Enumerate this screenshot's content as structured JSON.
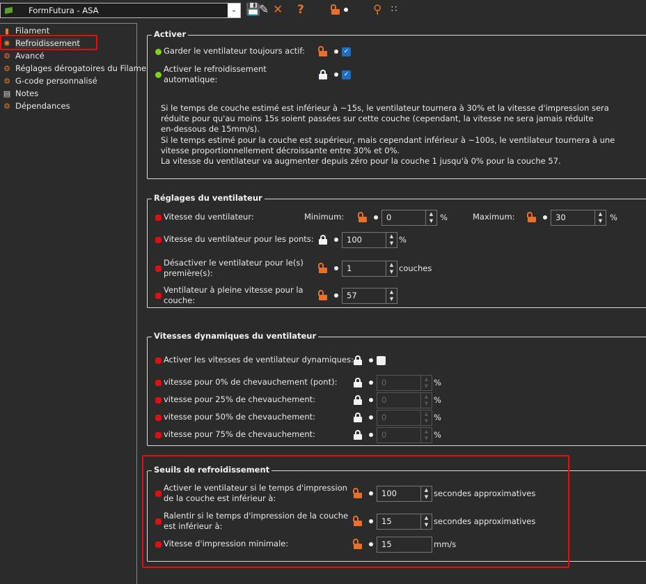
{
  "toolbar": {
    "preset": "FormFutura - ASA",
    "icons": [
      "save-icon",
      "edit-icon",
      "delete-icon",
      "help-icon",
      "lock-open-icon",
      "dot-icon",
      "search-icon",
      "compare-icon"
    ]
  },
  "colors": {
    "orange": "#e8702a",
    "green": "#7ed321",
    "red": "#e01010",
    "checkbox": "#1e6fc4"
  },
  "sidebar": {
    "items": [
      {
        "label": "Filament",
        "icon": "filament-icon"
      },
      {
        "label": "Refroidissement",
        "icon": "fan-icon",
        "selected": true
      },
      {
        "label": "Avancé",
        "icon": "gears-icon"
      },
      {
        "label": "Réglages dérogatoires du Filame",
        "icon": "gears-icon"
      },
      {
        "label": "G-code personnalisé",
        "icon": "gcode-icon"
      },
      {
        "label": "Notes",
        "icon": "notes-icon"
      },
      {
        "label": "Dépendances",
        "icon": "gears-icon"
      }
    ]
  },
  "groups": [
    {
      "title": "Activer",
      "rows": [
        {
          "label": "Garder le ventilateur toujours actif:",
          "status": "green",
          "lock": "open",
          "type": "checkbox",
          "checked": true
        },
        {
          "label": "Activer le refroidissement\nautomatique:",
          "status": "green",
          "lock": "closed",
          "type": "checkbox",
          "checked": true
        }
      ],
      "description": "Si le temps de couche estimé est inférieur à ~15s, le ventilateur tournera à 30% et la vitesse d'impression sera\nréduite pour qu'au moins 15s soient passées sur cette couche (cependant, la vitesse ne sera jamais réduite\nen-dessous de 15mm/s).\nSi le temps estimé pour la couche est supérieur, mais cependant inférieur à ~100s, le ventilateur tournera à une\nvitesse proportionnellement décroissante entre 30% et 0%.\nLa vitesse du ventilateur va augmenter depuis zéro pour la couche 1 jusqu'à 0% pour la couche 57."
    },
    {
      "title": "Réglages du ventilateur",
      "rows": [
        {
          "label": "Vitesse du ventilateur:",
          "status": "red",
          "sub": [
            {
              "label": "Minimum:",
              "lock": "open",
              "value": "0",
              "unit": "%"
            },
            {
              "label": "Maximum:",
              "lock": "open",
              "value": "30",
              "unit": "%"
            }
          ]
        },
        {
          "label": "Vitesse du ventilateur pour les ponts:",
          "status": "red",
          "lock": "closed",
          "type": "spin",
          "value": "100",
          "unit": "%"
        },
        {
          "label": "Désactiver le ventilateur pour le(s)\npremière(s):",
          "status": "red",
          "lock": "open",
          "type": "spin",
          "value": "1",
          "unit": "couches"
        },
        {
          "label": "Ventilateur à pleine vitesse pour la\ncouche:",
          "status": "red",
          "lock": "open",
          "type": "spin",
          "value": "57",
          "unit": ""
        }
      ]
    },
    {
      "title": "Vitesses dynamiques du ventilateur",
      "rows": [
        {
          "label": "Activer les vitesses de ventilateur dynamiques:",
          "status": "red",
          "lock": "closed",
          "type": "checkbox",
          "checked": false
        },
        {
          "label": "vitesse pour 0% de chevauchement (pont):",
          "status": "red",
          "lock": "closed",
          "type": "spin",
          "value": "0",
          "unit": "%",
          "disabled": true
        },
        {
          "label": "vitesse pour 25% de chevauchement:",
          "status": "red",
          "lock": "closed",
          "type": "spin",
          "value": "0",
          "unit": "%",
          "disabled": true
        },
        {
          "label": "vitesse pour 50% de chevauchement:",
          "status": "red",
          "lock": "closed",
          "type": "spin",
          "value": "0",
          "unit": "%",
          "disabled": true
        },
        {
          "label": "vitesse pour 75% de chevauchement:",
          "status": "red",
          "lock": "closed",
          "type": "spin",
          "value": "0",
          "unit": "%",
          "disabled": true
        }
      ]
    },
    {
      "title": "Seuils de refroidissement",
      "rows": [
        {
          "label": "Activer le ventilateur si le temps d'impression\nde la couche est inférieur à:",
          "status": "red",
          "lock": "open",
          "type": "spin",
          "value": "100",
          "unit": "secondes approximatives"
        },
        {
          "label": "Ralentir si le temps d'impression de la couche\nest inférieur à:",
          "status": "red",
          "lock": "open",
          "type": "spin",
          "value": "15",
          "unit": "secondes approximatives"
        },
        {
          "label": "Vitesse d'impression minimale:",
          "status": "red",
          "lock": "open",
          "type": "text",
          "value": "15",
          "unit": "mm/s"
        }
      ]
    }
  ]
}
